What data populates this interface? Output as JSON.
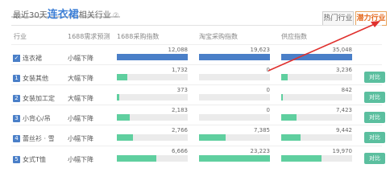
{
  "header": {
    "title_prefix": "最近30天",
    "title_highlight": "连衣裙",
    "title_suffix": "相关行业",
    "title_note": "②",
    "tabs": [
      {
        "label": "热门行业",
        "active": false
      },
      {
        "label": "潜力行业",
        "active": true
      }
    ]
  },
  "columns": {
    "industry": "行业",
    "trend": "1688需求预测",
    "purchase": "1688采购指数",
    "taobao": "淘宝采购指数",
    "supply": "供应指数"
  },
  "max": {
    "purchase": 12088,
    "taobao": 19623,
    "supply": 35048
  },
  "rows": [
    {
      "marker": "✓",
      "name": "连衣裙",
      "trend": "小幅下降",
      "purchase": "12,088",
      "purchase_v": 12088,
      "taobao": "19,623",
      "taobao_v": 19623,
      "supply": "35,048",
      "supply_v": 35048,
      "action": ""
    },
    {
      "marker": "1",
      "name": "女装其他",
      "trend": "大幅下降",
      "purchase": "1,732",
      "purchase_v": 1732,
      "taobao": "0",
      "taobao_v": 0,
      "supply": "3,236",
      "supply_v": 3236,
      "action": "对比"
    },
    {
      "marker": "2",
      "name": "女装加工定",
      "trend": "大幅下降",
      "purchase": "373",
      "purchase_v": 373,
      "taobao": "0",
      "taobao_v": 0,
      "supply": "842",
      "supply_v": 842,
      "action": "对比"
    },
    {
      "marker": "3",
      "name": "小背心/吊",
      "trend": "小幅下降",
      "purchase": "2,183",
      "purchase_v": 2183,
      "taobao": "0",
      "taobao_v": 0,
      "supply": "7,423",
      "supply_v": 7423,
      "action": "对比"
    },
    {
      "marker": "4",
      "name": "蕾丝衫 · 雪",
      "trend": "小幅下降",
      "purchase": "2,766",
      "purchase_v": 2766,
      "taobao": "7,385",
      "taobao_v": 7385,
      "supply": "9,442",
      "supply_v": 9442,
      "action": "对比"
    },
    {
      "marker": "5",
      "name": "女式T恤",
      "trend": "小幅下降",
      "purchase": "6,666",
      "purchase_v": 6666,
      "taobao": "23,223",
      "taobao_v": 23223,
      "supply": "19,970",
      "supply_v": 19970,
      "action": "对比"
    }
  ],
  "colors": {
    "highlight_bar": "#4a7fc8",
    "bar": "#5fcf9f",
    "button": "#5bbf9f",
    "arrow": "#e0302d",
    "active_tab": "#e56b1f"
  }
}
